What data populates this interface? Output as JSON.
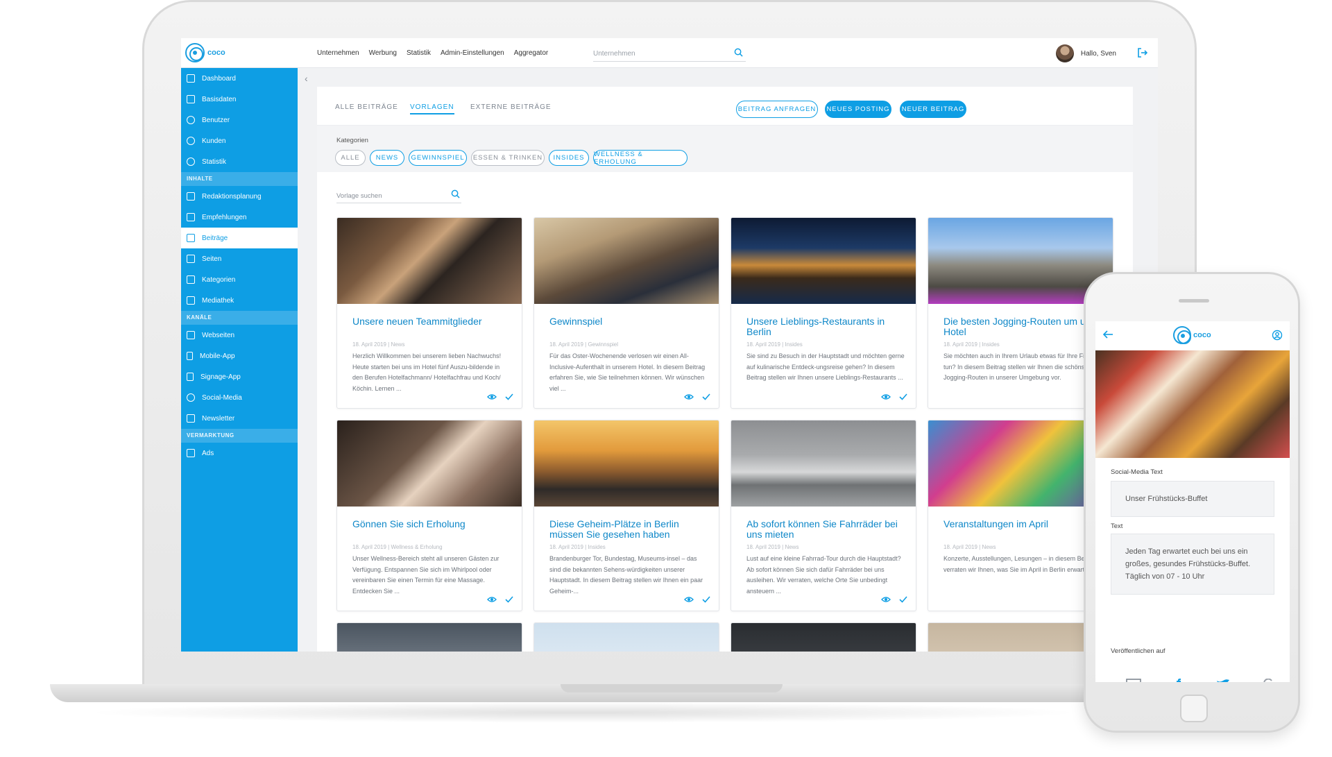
{
  "app": {
    "logo_text": "coco",
    "accent": "#0e9ee4"
  },
  "topnav": {
    "items": [
      "Unternehmen",
      "Werbung",
      "Statistik",
      "Admin-Einstellungen",
      "Aggregator"
    ],
    "search_placeholder": "Unternehmen",
    "greeting": "Hallo, Sven"
  },
  "sidebar": {
    "items_top": [
      "Dashboard",
      "Basisdaten",
      "Benutzer",
      "Kunden",
      "Statistik"
    ],
    "section_inhalte": "INHALTE",
    "items_inhalte": [
      "Redaktionsplanung",
      "Empfehlungen",
      "Beiträge",
      "Seiten",
      "Kategorien",
      "Mediathek"
    ],
    "section_kanaele": "KANÄLE",
    "items_kanaele": [
      "Webseiten",
      "Mobile-App",
      "Signage-App",
      "Social-Media",
      "Newsletter"
    ],
    "section_vermarktung": "VERMARKTUNG",
    "items_vermarktung": [
      "Ads"
    ]
  },
  "tabs": [
    "ALLE BEITRÄGE",
    "VORLAGEN",
    "EXTERNE BEITRÄGE"
  ],
  "buttons": {
    "request": "BEITRAG ANFRAGEN",
    "new_posting": "NEUES POSTING",
    "new_post": "NEUER BEITRAG"
  },
  "categories": {
    "label": "Kategorien",
    "chips": [
      "ALLE",
      "NEWS",
      "GEWINNSPIEL",
      "ESSEN & TRINKEN",
      "INSIDES",
      "WELLNESS & ERHOLUNG"
    ]
  },
  "template_search_placeholder": "Vorlage suchen",
  "cards": [
    {
      "title": "Unsere neuen Teammitglieder",
      "meta": "18. April 2019 | News",
      "body": "Herzlich Willkommen bei unserem lieben Nachwuchs! Heute starten bei uns im Hotel fünf Auszu-bildende in den Berufen Hotelfachmann/ Hotelfachfrau und Koch/ Köchin. Lernen ..."
    },
    {
      "title": "Gewinnspiel",
      "meta": "18. April 2019 | Gewinnspiel",
      "body": "Für das Oster-Wochenende verlosen wir einen All-Inclusive-Aufenthalt in unserem Hotel. In diesem Beitrag erfahren Sie, wie Sie teilnehmen können. Wir wünschen viel ..."
    },
    {
      "title": "Unsere Lieblings-Restaurants in Berlin",
      "meta": "18. April 2019 | Insides",
      "body": "Sie sind zu Besuch in der Hauptstadt und möchten gerne auf kulinarische Entdeck-ungsreise gehen? In diesem Beitrag stellen wir Ihnen unsere Lieblings-Restaurants ..."
    },
    {
      "title": "Die besten Jogging-Routen um unser Hotel",
      "meta": "18. April 2019 | Insides",
      "body": "Sie möchten auch in Ihrem Urlaub etwas für Ihre Fitness tun? In diesem Beitrag stellen wir Ihnen die schönsten Jogging-Routen in unserer Umgebung vor."
    },
    {
      "title": "Gönnen Sie sich Erholung",
      "meta": "18. April 2019 | Wellness & Erholung",
      "body": "Unser Wellness-Bereich steht all unseren Gästen zur Verfügung. Entspannen Sie sich im Whirlpool oder vereinbaren Sie einen Termin für eine Massage. Entdecken Sie ..."
    },
    {
      "title": "Diese Geheim-Plätze in Berlin müssen Sie gesehen haben",
      "meta": "18. April 2019 | Insides",
      "body": "Brandenburger Tor, Bundestag, Museums-insel – das sind die bekannten Sehens-würdigkeiten unserer Hauptstadt. In diesem Beitrag stellen wir Ihnen ein paar Geheim-..."
    },
    {
      "title": "Ab sofort können Sie Fahrräder bei uns mieten",
      "meta": "18. April 2019 | News",
      "body": "Lust auf eine kleine Fahrrad-Tour durch die Hauptstadt? Ab sofort können Sie sich dafür Fahrräder bei uns ausleihen. Wir verraten, welche Orte Sie unbedingt ansteuern ..."
    },
    {
      "title": "Veranstaltungen im April",
      "meta": "18. April 2019 | News",
      "body": "Konzerte, Ausstellungen, Lesungen – in diesem Beitrag verraten wir Ihnen, was Sie im April in Berlin erwartet."
    }
  ],
  "phone": {
    "logo_text": "coco",
    "social_label": "Social-Media Text",
    "social_value": "Unser Frühstücks-Buffet",
    "text_label": "Text",
    "text_value": "Jeden Tag erwartet euch bei uns ein großes, gesundes Frühstücks-Buffet. Täglich von 07 - 10 Uhr",
    "publish_label": "Veröffentlichen auf"
  }
}
